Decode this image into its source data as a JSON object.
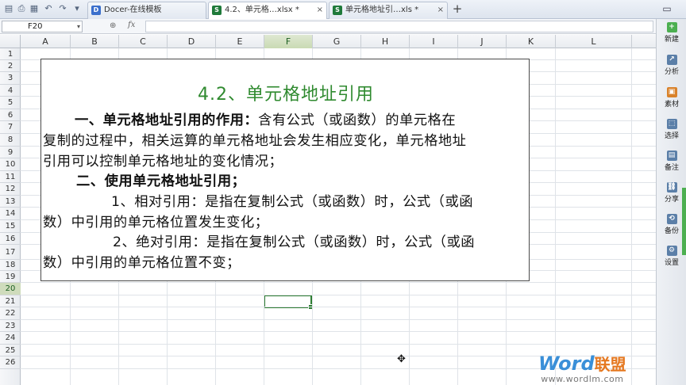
{
  "tabs": [
    {
      "label": "Docer-在线模板",
      "icon": "docer-icon",
      "icon_color": "#3b6fcc",
      "active": false
    },
    {
      "label": "4.2、单元格…xlsx *",
      "icon": "spreadsheet-icon",
      "icon_color": "#1f7a3a",
      "active": true
    },
    {
      "label": "单元格地址引…xls *",
      "icon": "spreadsheet-icon",
      "icon_color": "#1f7a3a",
      "active": false
    }
  ],
  "tab_close_glyph": "×",
  "tab_add_glyph": "+",
  "formula_bar": {
    "cell_ref": "F20",
    "formula": ""
  },
  "columns": [
    "A",
    "B",
    "C",
    "D",
    "E",
    "F",
    "G",
    "H",
    "I",
    "J",
    "K",
    "L"
  ],
  "rows": [
    "1",
    "2",
    "3",
    "4",
    "5",
    "6",
    "7",
    "8",
    "9",
    "10",
    "11",
    "12",
    "13",
    "14",
    "15",
    "16",
    "17",
    "18",
    "19",
    "20",
    "21",
    "22",
    "23",
    "24",
    "25",
    "26"
  ],
  "selected": {
    "column": "F",
    "row": "20"
  },
  "textbox": {
    "title": "4.2、单元格地址引用",
    "lines": [
      "一、单元格地址引用的作用：含有公式（或函数）的单元格在",
      "复制的过程中，相关运算的单元格地址会发生相应变化，单元格地址",
      "引用可以控制单元格地址的变化情况；",
      "二、使用单元格地址引用；",
      "1、相对引用：是指在复制公式（或函数）时，公式（或函",
      "数）中引用的单元格位置发生变化；",
      "2、绝对引用：是指在复制公式（或函数）时，公式（或函",
      "数）中引用的单元格位置不变；"
    ]
  },
  "right_panel": [
    {
      "label": "新建",
      "icon": "new-icon",
      "color": "#4caf50"
    },
    {
      "label": "分析",
      "icon": "analyze-icon",
      "color": "#5b7fa8"
    },
    {
      "label": "素材",
      "icon": "material-icon",
      "color": "#d9822b"
    },
    {
      "label": "选择",
      "icon": "select-icon",
      "color": "#5b7fa8"
    },
    {
      "label": "备注",
      "icon": "note-icon",
      "color": "#5b7fa8"
    },
    {
      "label": "分享",
      "icon": "share-icon",
      "color": "#5b7fa8"
    },
    {
      "label": "备份",
      "icon": "backup-icon",
      "color": "#5b7fa8"
    },
    {
      "label": "设置",
      "icon": "settings-icon",
      "color": "#5b7fa8"
    }
  ],
  "watermark": {
    "brand": "Word",
    "brand_cn": "联盟",
    "url": "www.wordlm.com"
  },
  "colors": {
    "accent_green": "#2e7d32",
    "title_green": "#2f8a2f"
  }
}
